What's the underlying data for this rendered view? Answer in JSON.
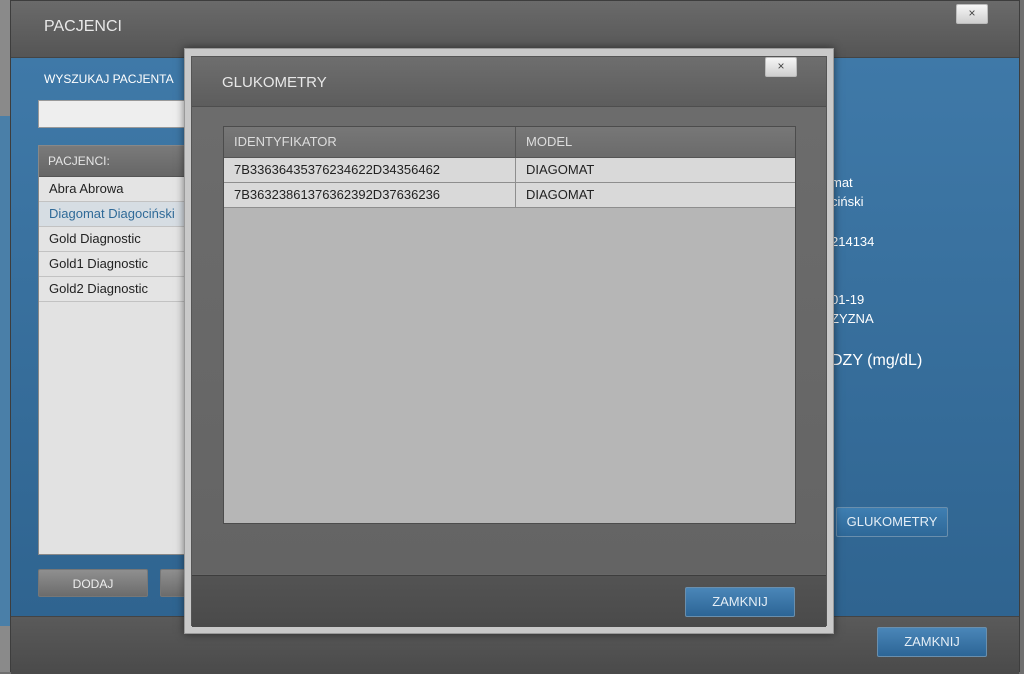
{
  "main_window": {
    "title": "PACJENCI",
    "close_label": "×",
    "search": {
      "label": "WYSZUKAJ PACJENTA",
      "value": "",
      "placeholder": ""
    },
    "patients": {
      "header": "PACJENCI:",
      "items": [
        {
          "name": "Abra Abrowa",
          "selected": false
        },
        {
          "name": "Diagomat Diagociński",
          "selected": true
        },
        {
          "name": "Gold Diagnostic",
          "selected": false
        },
        {
          "name": "Gold1 Diagnostic",
          "selected": false
        },
        {
          "name": "Gold2 Diagnostic",
          "selected": false
        }
      ]
    },
    "add_button": "DODAJ",
    "details": {
      "line1": "mat",
      "line2": "ciński",
      "line3": "214134",
      "line4": "01-19",
      "line5": "ZYZNA",
      "glucose_unit_label": "DZY (mg/dL)"
    },
    "glukometry_button": "GLUKOMETRY",
    "close_button": "ZAMKNIJ"
  },
  "modal": {
    "title": "GLUKOMETRY",
    "close_label": "×",
    "table": {
      "columns": [
        "IDENTYFIKATOR",
        "MODEL"
      ],
      "rows": [
        {
          "id": "7B33636435376234622D34356462",
          "model": "DIAGOMAT"
        },
        {
          "id": "7B36323861376362392D37636236",
          "model": "DIAGOMAT"
        }
      ]
    },
    "close_button": "ZAMKNIJ"
  }
}
